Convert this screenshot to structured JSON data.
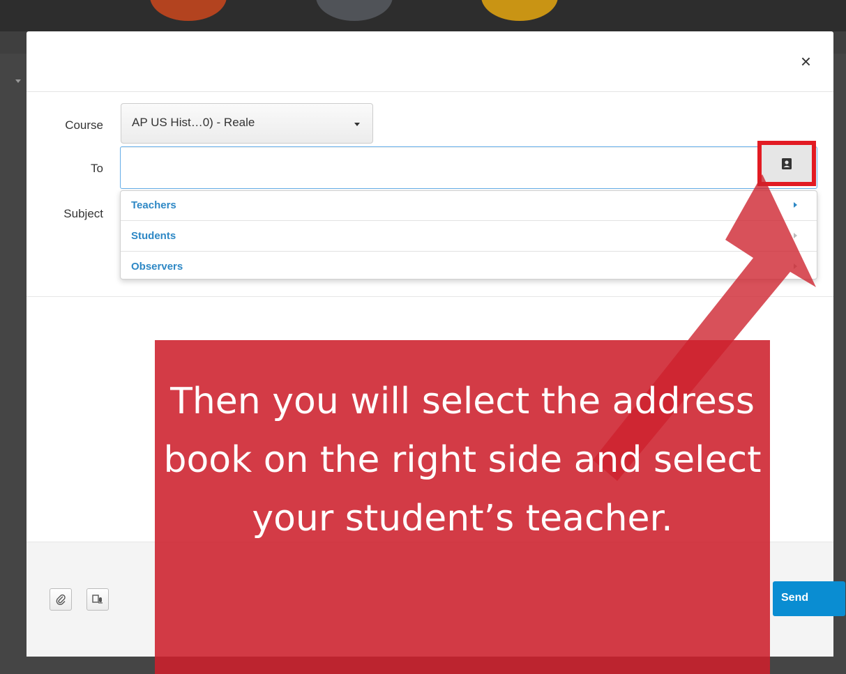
{
  "modal": {
    "close_label": "×",
    "course_label": "Course",
    "course_value": "AP US Hist…0) - Reale",
    "to_label": "To",
    "to_value": "",
    "subject_label": "Subject",
    "recipient_menu": [
      {
        "label": "Teachers"
      },
      {
        "label": "Students"
      },
      {
        "label": "Observers"
      }
    ],
    "send_label": "Send",
    "address_book_icon": "address-book-icon",
    "attach_icon": "paperclip-icon",
    "media_icon": "media-record-icon"
  },
  "callout": {
    "text": "Then you will select the address book on the right side and select your student’s teacher."
  },
  "colors": {
    "highlight": "#e21b23",
    "callout_bg": "#cd202c",
    "link": "#2e88c5",
    "send": "#0a8dd2"
  }
}
